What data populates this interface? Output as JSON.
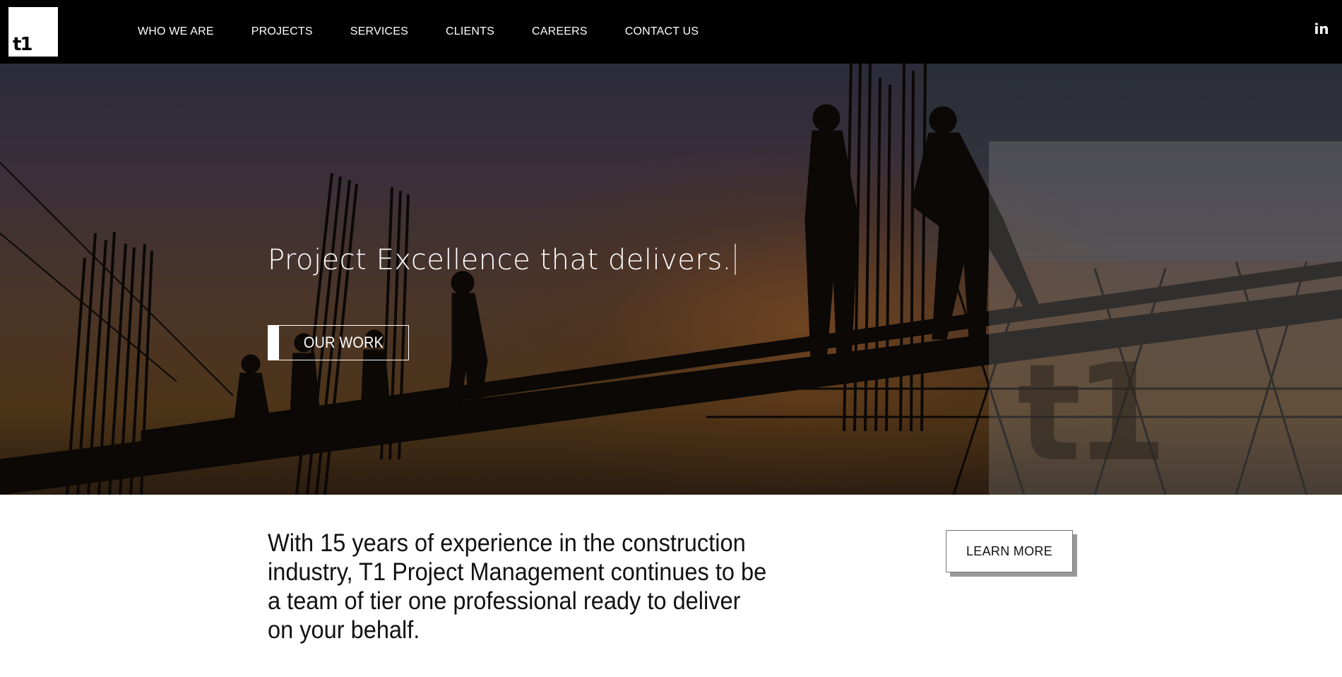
{
  "header": {
    "logo_text": "t1",
    "nav": [
      {
        "label": "WHO WE ARE"
      },
      {
        "label": "PROJECTS"
      },
      {
        "label": "SERVICES"
      },
      {
        "label": "CLIENTS"
      },
      {
        "label": "CAREERS"
      },
      {
        "label": "CONTACT US"
      }
    ],
    "social_icon": "linkedin-icon",
    "social_glyph": "in"
  },
  "hero": {
    "title": "Project Excellence that delivers.",
    "button_label": "OUR WORK",
    "overlay_mark": "t1"
  },
  "intro": {
    "text": "With 15 years of experience in the construction industry, T1 Project Management continues to be a team of tier one professional ready to deliver on your behalf.",
    "button_label": "LEARN MORE"
  },
  "colors": {
    "header_bg": "#000000",
    "accent": "#ffffff",
    "text": "#111111"
  }
}
